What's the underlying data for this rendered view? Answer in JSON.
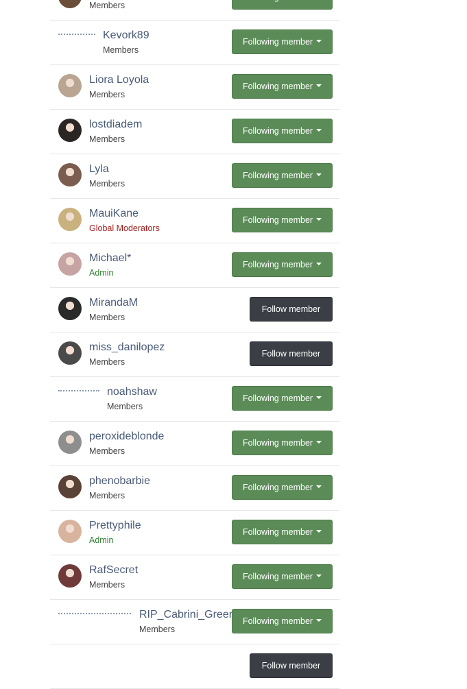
{
  "labels": {
    "following": "Following member",
    "follow": "Follow member"
  },
  "members": [
    {
      "name": "",
      "group": "Members",
      "group_type": "member",
      "state": "following",
      "avatar": "photo",
      "avatar_color": "#6b4e3a"
    },
    {
      "name": "Kevork89",
      "group": "Members",
      "group_type": "member",
      "state": "following",
      "avatar": "broken"
    },
    {
      "name": "Liora Loyola",
      "group": "Members",
      "group_type": "member",
      "state": "following",
      "avatar": "photo",
      "avatar_color": "#b9a592"
    },
    {
      "name": "lostdiadem",
      "group": "Members",
      "group_type": "member",
      "state": "following",
      "avatar": "photo",
      "avatar_color": "#2b2623"
    },
    {
      "name": "Lyla",
      "group": "Members",
      "group_type": "member",
      "state": "following",
      "avatar": "photo",
      "avatar_color": "#7a5d4f"
    },
    {
      "name": "MauiKane",
      "group": "Global Moderators",
      "group_type": "gm",
      "state": "following",
      "avatar": "photo",
      "avatar_color": "#c9b27e"
    },
    {
      "name": "Michael*",
      "group": "Admin",
      "group_type": "admin",
      "state": "following",
      "avatar": "photo",
      "avatar_color": "#c7a4a4"
    },
    {
      "name": "MirandaM",
      "group": "Members",
      "group_type": "member",
      "state": "follow",
      "avatar": "photo",
      "avatar_color": "#2a2a2a"
    },
    {
      "name": "miss_danilopez",
      "group": "Members",
      "group_type": "member",
      "state": "follow",
      "avatar": "photo",
      "avatar_color": "#4a4a4a"
    },
    {
      "name": "noahshaw",
      "group": "Members",
      "group_type": "member",
      "state": "following",
      "avatar": "broken"
    },
    {
      "name": "peroxideblonde",
      "group": "Members",
      "group_type": "member",
      "state": "following",
      "avatar": "photo",
      "avatar_color": "#8e8e8e"
    },
    {
      "name": "phenobarbie",
      "group": "Members",
      "group_type": "member",
      "state": "following",
      "avatar": "photo",
      "avatar_color": "#5a4238"
    },
    {
      "name": "Prettyphile",
      "group": "Admin",
      "group_type": "admin",
      "state": "following",
      "avatar": "photo",
      "avatar_color": "#d8b49e"
    },
    {
      "name": "RafSecret",
      "group": "Members",
      "group_type": "member",
      "state": "following",
      "avatar": "photo",
      "avatar_color": "#6e3a3a"
    },
    {
      "name": "RIP_Cabrini_Green",
      "group": "Members",
      "group_type": "member",
      "state": "following",
      "avatar": "broken"
    },
    {
      "name": "",
      "group": "",
      "group_type": "member",
      "state": "follow",
      "avatar": "none"
    }
  ]
}
